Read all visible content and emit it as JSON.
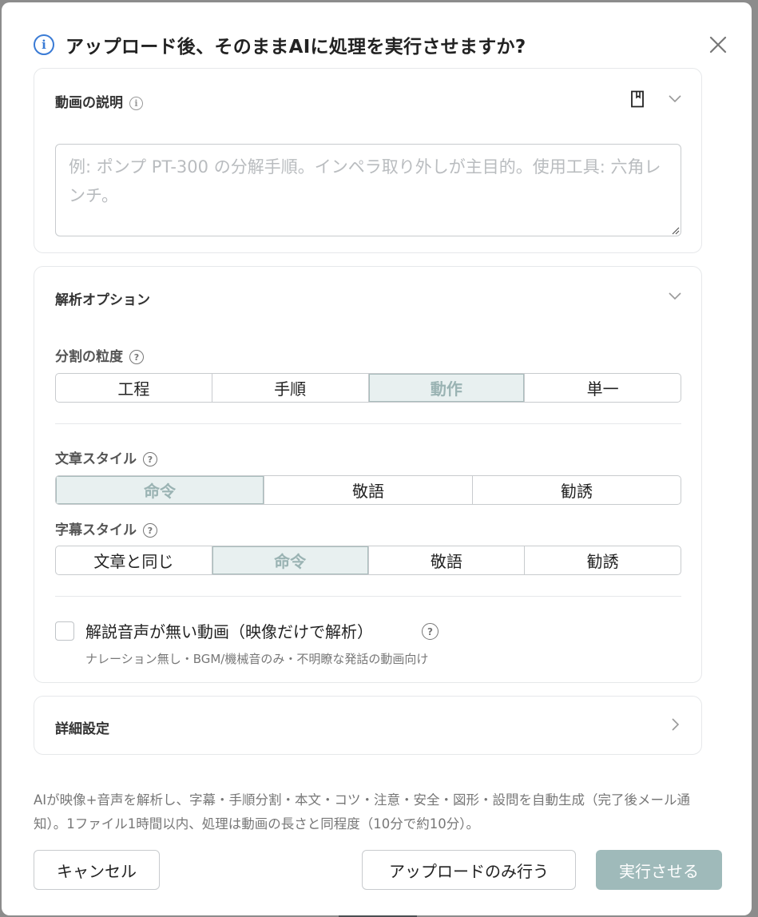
{
  "dialog": {
    "title": "アップロード後、そのままAIに処理を実行させますか?",
    "close_icon": "close-icon",
    "info_icon": "info-circle-icon",
    "accent_color": "#3a7bd5"
  },
  "description": {
    "title": "動画の説明",
    "placeholder": "例: ポンプ PT-300 の分解手順。インペラ取り外しが主目的。使用工具: 六角レンチ。",
    "value": ""
  },
  "analysis": {
    "title": "解析オプション",
    "granularity": {
      "label": "分割の粒度",
      "options": [
        "工程",
        "手順",
        "動作",
        "単一"
      ],
      "selected": "動作"
    },
    "text_style": {
      "label": "文章スタイル",
      "options": [
        "命令",
        "敬語",
        "勧誘"
      ],
      "selected": "命令"
    },
    "subtitle_style": {
      "label": "字幕スタイル",
      "options": [
        "文章と同じ",
        "命令",
        "敬語",
        "勧誘"
      ],
      "selected": "命令"
    },
    "no_narration": {
      "label": "解説音声が無い動画（映像だけで解析）",
      "sublabel": "ナレーション無し・BGM/機械音のみ・不明瞭な発話の動画向け",
      "checked": false
    }
  },
  "advanced": {
    "title": "詳細設定"
  },
  "footer": {
    "note": "AIが映像+音声を解析し、字幕・手順分割・本文・コツ・注意・安全・図形・設問を自動生成（完了後メール通知）。1ファイル1時間以内、処理は動画の長さと同程度（10分で約10分）。",
    "cancel_label": "キャンセル",
    "upload_only_label": "アップロードのみ行う",
    "run_label": "実行させる",
    "primary_color": "#9fbaba"
  }
}
